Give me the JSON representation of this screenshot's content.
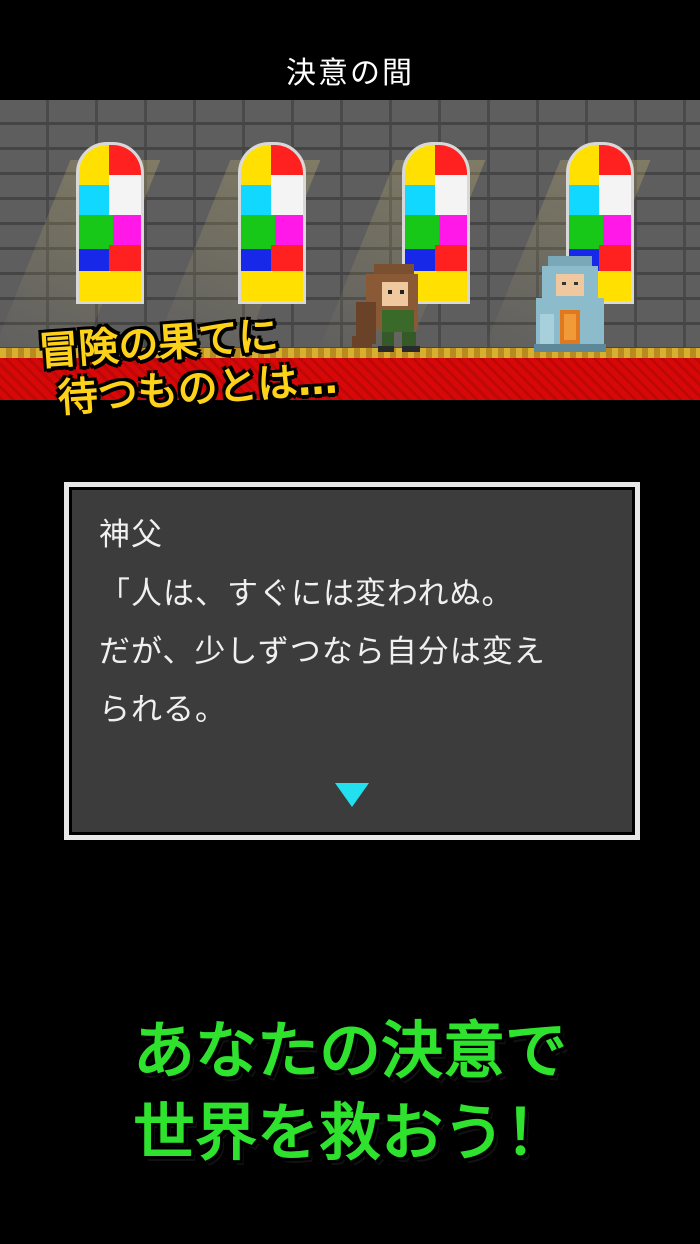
{
  "location": {
    "title": "決意の間"
  },
  "tagline": {
    "line1": "冒険の果てに",
    "line2": "待つものとは…"
  },
  "dialog": {
    "speaker": "神父",
    "lines": [
      "「人は、すぐには変われぬ。",
      "だが、少しずつなら自分は変え",
      "られる。"
    ]
  },
  "catchphrase": {
    "line1": "あなたの決意で",
    "line2": "世界を救おう！"
  },
  "colors": {
    "catch": "#2ee22e",
    "tagline": "#ffd21a",
    "carpet": "#d80808",
    "arrow": "#22e0ee"
  }
}
